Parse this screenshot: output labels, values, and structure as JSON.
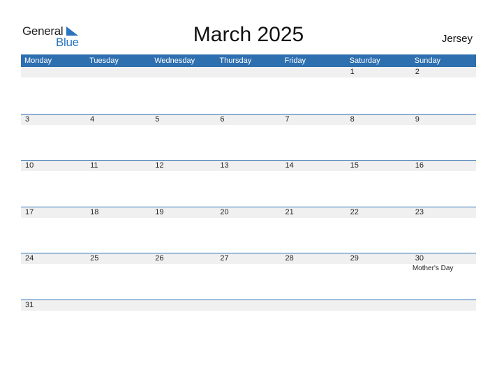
{
  "logo": {
    "word1": "General",
    "word2": "Blue"
  },
  "title": "March 2025",
  "region": "Jersey",
  "colors": {
    "header_bg": "#2e6fb0",
    "accent": "#2a75bd",
    "day_strip": "#f0f0f0"
  },
  "weekdays": [
    "Monday",
    "Tuesday",
    "Wednesday",
    "Thursday",
    "Friday",
    "Saturday",
    "Sunday"
  ],
  "weeks": [
    [
      "",
      "",
      "",
      "",
      "",
      "1",
      "2"
    ],
    [
      "3",
      "4",
      "5",
      "6",
      "7",
      "8",
      "9"
    ],
    [
      "10",
      "11",
      "12",
      "13",
      "14",
      "15",
      "16"
    ],
    [
      "17",
      "18",
      "19",
      "20",
      "21",
      "22",
      "23"
    ],
    [
      "24",
      "25",
      "26",
      "27",
      "28",
      "29",
      "30"
    ],
    [
      "31",
      "",
      "",
      "",
      "",
      "",
      ""
    ]
  ],
  "holidays": [
    {
      "day": "30",
      "week": 4,
      "col": 6,
      "label": "Mother's Day"
    }
  ]
}
